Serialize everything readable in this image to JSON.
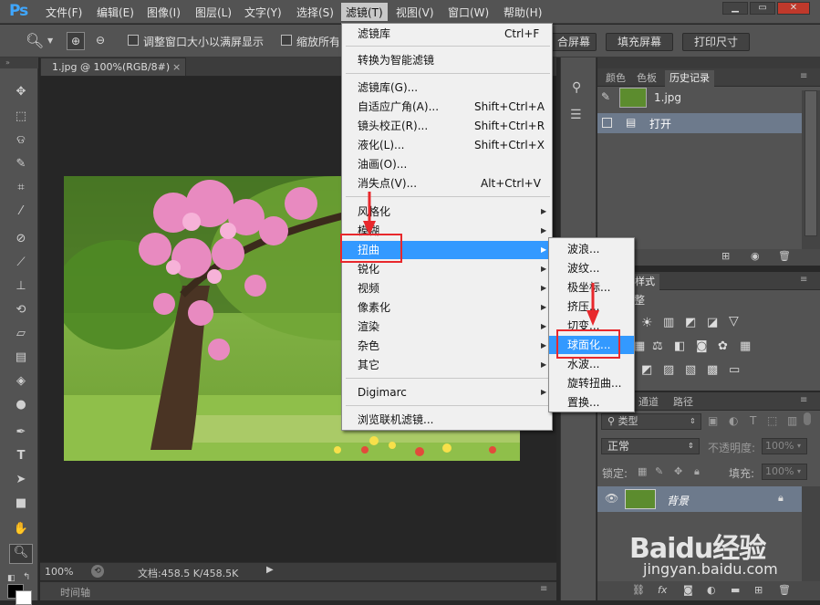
{
  "app": {
    "logo": "Ps"
  },
  "menubar": {
    "items": [
      "文件(F)",
      "编辑(E)",
      "图像(I)",
      "图层(L)",
      "文字(Y)",
      "选择(S)",
      "滤镜(T)",
      "视图(V)",
      "窗口(W)",
      "帮助(H)"
    ],
    "active_index": 6
  },
  "options": {
    "resize_label": "调整窗口大小以满屏显示",
    "zoom_all_label": "缩放所有",
    "fit_button": "合屏幕",
    "fill_button": "填充屏幕",
    "print_button": "打印尺寸"
  },
  "document": {
    "tab_title": "1.jpg @ 100%(RGB/8#)",
    "zoom": "100%",
    "doc_info": "文档:458.5 K/458.5K",
    "timeline_label": "时间轴"
  },
  "filter_menu": {
    "items": [
      {
        "label": "滤镜库",
        "shortcut": "Ctrl+F"
      },
      {
        "label": "转换为智能滤镜",
        "shortcut": ""
      },
      {
        "label": "滤镜库(G)...",
        "shortcut": ""
      },
      {
        "label": "自适应广角(A)...",
        "shortcut": "Shift+Ctrl+A"
      },
      {
        "label": "镜头校正(R)...",
        "shortcut": "Shift+Ctrl+R"
      },
      {
        "label": "液化(L)...",
        "shortcut": "Shift+Ctrl+X"
      },
      {
        "label": "油画(O)...",
        "shortcut": ""
      },
      {
        "label": "消失点(V)...",
        "shortcut": "Alt+Ctrl+V"
      },
      {
        "label": "风格化",
        "shortcut": ""
      },
      {
        "label": "模糊",
        "shortcut": ""
      },
      {
        "label": "扭曲",
        "shortcut": ""
      },
      {
        "label": "锐化",
        "shortcut": ""
      },
      {
        "label": "视频",
        "shortcut": ""
      },
      {
        "label": "像素化",
        "shortcut": ""
      },
      {
        "label": "渲染",
        "shortcut": ""
      },
      {
        "label": "杂色",
        "shortcut": ""
      },
      {
        "label": "其它",
        "shortcut": ""
      },
      {
        "label": "Digimarc",
        "shortcut": ""
      },
      {
        "label": "浏览联机滤镜...",
        "shortcut": ""
      }
    ],
    "highlighted": "扭曲"
  },
  "distort_submenu": {
    "items": [
      "波浪...",
      "波纹...",
      "极坐标...",
      "挤压...",
      "切变...",
      "球面化...",
      "水波...",
      "旋转扭曲...",
      "置换..."
    ],
    "highlighted": "球面化..."
  },
  "history_panel": {
    "tabs": [
      "颜色",
      "色板",
      "历史记录"
    ],
    "selected_tab": "历史记录",
    "snapshot": "1.jpg",
    "states": [
      "打开"
    ]
  },
  "adjust_panel": {
    "tab": "样式",
    "title": "整"
  },
  "layers_panel": {
    "tabs": [
      "通道",
      "路径"
    ],
    "filter_kind": "类型",
    "blend_mode": "正常",
    "opacity_label": "不透明度:",
    "opacity_value": "100%",
    "lock_label": "锁定:",
    "fill_label": "填充:",
    "fill_value": "100%",
    "layers": [
      {
        "name": "背景"
      }
    ]
  },
  "watermark": {
    "text": "Baidu经验",
    "url": "jingyan.baidu.com"
  },
  "colors": {
    "accent": "#3399ff",
    "annotation": "#e8282c",
    "ps_blue": "#3fa7ff"
  }
}
